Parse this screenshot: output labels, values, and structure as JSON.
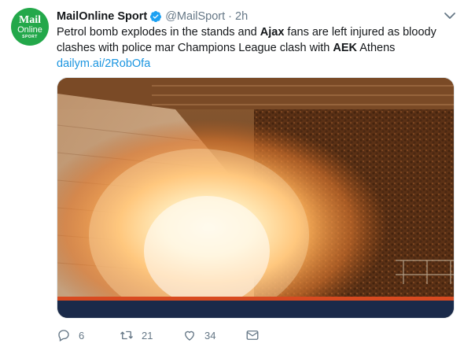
{
  "tweet": {
    "avatar": {
      "line1": "Mail",
      "line2": "Online",
      "line3": "SPORT"
    },
    "author_name": "MailOnline Sport",
    "handle": "@MailSport",
    "separator": "·",
    "time": "2h",
    "text_parts": [
      "Petrol bomb explodes in the stands and ",
      "Ajax",
      " fans are left injured as bloody clashes with police mar Champions League clash with ",
      "AEK",
      " Athens "
    ],
    "link_text": "dailym.ai/2RobOfa",
    "media_description_icon": "photo",
    "counts": {
      "replies": "6",
      "retweets": "21",
      "likes": "34"
    }
  },
  "colors": {
    "avatar_green": "#23a84a",
    "link_blue": "#1b95e0",
    "muted_gray": "#657786",
    "verified_blue": "#1da1f2"
  },
  "icons": [
    "verified-badge-icon",
    "chevron-down-icon",
    "reply-icon",
    "retweet-icon",
    "like-icon",
    "direct-message-icon"
  ]
}
